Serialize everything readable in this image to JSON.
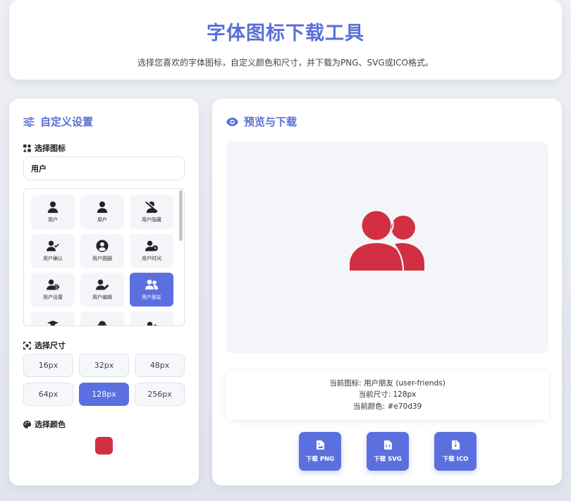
{
  "header": {
    "title": "字体图标下载工具",
    "subtitle": "选择您喜欢的字体图标，自定义颜色和尺寸，并下载为PNG、SVG或ICO格式。"
  },
  "left_panel": {
    "title": "自定义设置",
    "title_icon": "sliders-icon",
    "icon_section_label": "选择图标",
    "search_value": "用户",
    "icons": [
      {
        "label": "用户",
        "icon": "user-icon"
      },
      {
        "label": "用户",
        "icon": "user-icon"
      },
      {
        "label": "用户隐藏",
        "icon": "user-slash-icon"
      },
      {
        "label": "用户确认",
        "icon": "user-check-icon"
      },
      {
        "label": "用户圆圈",
        "icon": "user-circle-icon"
      },
      {
        "label": "用户时间",
        "icon": "user-clock-icon"
      },
      {
        "label": "用户设置",
        "icon": "user-cog-icon"
      },
      {
        "label": "用户编辑",
        "icon": "user-edit-icon"
      },
      {
        "label": "用户朋友",
        "icon": "user-friends-icon",
        "selected": true
      },
      {
        "label": "",
        "icon": "user-graduate-icon"
      },
      {
        "label": "",
        "icon": "user-hard-hat-icon"
      },
      {
        "label": "",
        "icon": "user-lock-icon"
      }
    ],
    "size_section_label": "选择尺寸",
    "sizes": [
      "16px",
      "32px",
      "48px",
      "64px",
      "128px",
      "256px"
    ],
    "selected_size": "128px",
    "color_section_label": "选择颜色",
    "selected_color": "#d22f42"
  },
  "right_panel": {
    "title": "预览与下载",
    "title_icon": "eye-icon",
    "preview_icon": "user-friends-icon",
    "preview_color": "#d22f42",
    "info": {
      "current_icon": "当前图标: 用户朋友 (user-friends)",
      "current_size": "当前尺寸: 128px",
      "current_color": "当前颜色: #e70d39"
    },
    "buttons": [
      {
        "label": "下载 PNG",
        "icon": "file-image-icon"
      },
      {
        "label": "下载 SVG",
        "icon": "file-code-icon"
      },
      {
        "label": "下载 ICO",
        "icon": "file-archive-icon"
      }
    ]
  },
  "colors": {
    "accent": "#5b70de",
    "title": "#5a6fd6"
  }
}
